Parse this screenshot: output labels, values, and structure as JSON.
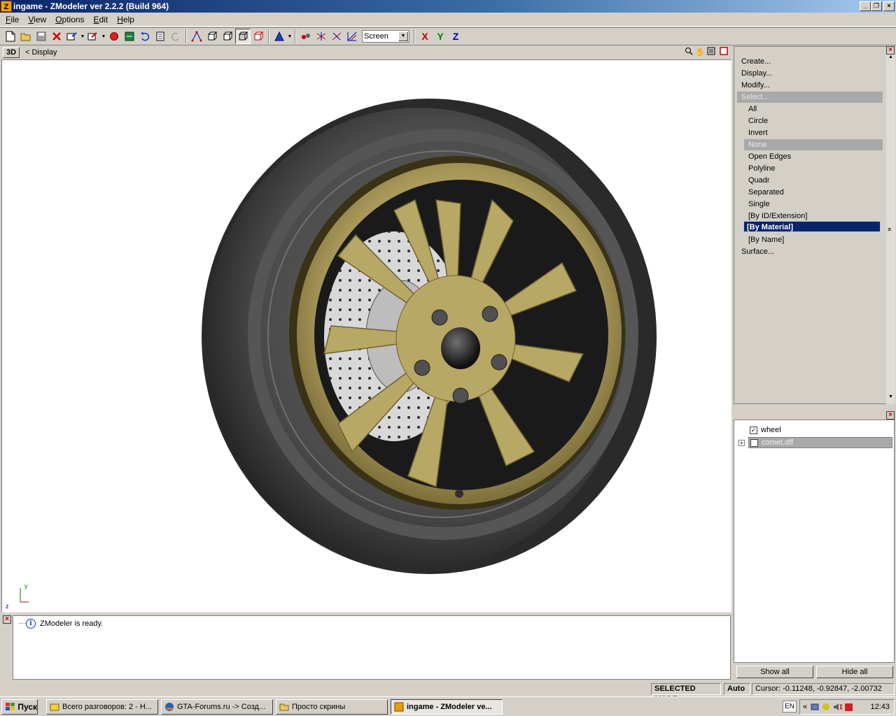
{
  "window": {
    "title": "ingame - ZModeler ver 2.2.2 (Build 964)",
    "app_icon_letter": "Z",
    "controls": [
      "_",
      "❐",
      "×"
    ]
  },
  "menu": {
    "items": [
      {
        "label": "File",
        "accel": "F",
        "rest": "ile"
      },
      {
        "label": "View",
        "accel": "V",
        "rest": "iew"
      },
      {
        "label": "Options",
        "accel": "O",
        "rest": "ptions"
      },
      {
        "label": "Edit",
        "accel": "E",
        "rest": "dit"
      },
      {
        "label": "Help",
        "accel": "H",
        "rest": "elp"
      }
    ]
  },
  "toolbar": {
    "view_select_value": "Screen",
    "axis_x": "X",
    "axis_y": "Y",
    "axis_z": "Z",
    "colors": {
      "axis_x": "#c00000",
      "axis_y": "#008000",
      "axis_z": "#0000c0"
    }
  },
  "viewport": {
    "mode_label": "3D",
    "display_label": "<  Display",
    "axis_y": "y",
    "axis_z": "z"
  },
  "command_panel": {
    "top_items": [
      "Create...",
      "Display...",
      "Modify..."
    ],
    "select_header": "Select...",
    "select_items": [
      "All",
      "Circle",
      "Invert"
    ],
    "none_header": "None",
    "more_items": [
      "Open Edges",
      "Polyline",
      "Quadr",
      "Separated",
      "Single",
      "[By ID/Extension]"
    ],
    "selected_item": "[By Material]",
    "after_selected": "[By Name]",
    "bottom_item": "Surface..."
  },
  "hierarchy": {
    "items": [
      {
        "label": "wheel",
        "checked": true
      },
      {
        "label": "comet.dff",
        "checked": false,
        "selected": true
      }
    ],
    "show_all": "Show all",
    "hide_all": "Hide all"
  },
  "log": {
    "message": "ZModeler is ready."
  },
  "status": {
    "mode": "SELECTED MODE",
    "auto": "Auto",
    "cursor": "Cursor: -0.11248, -0.92847, -2.00732"
  },
  "taskbar": {
    "start": "Пуск",
    "tasks": [
      {
        "label": "Всего разговоров: 2 - Н...",
        "active": false
      },
      {
        "label": "GTA-Forums.ru -> Созд...",
        "active": false
      },
      {
        "label": "Просто скрины",
        "active": false
      },
      {
        "label": "ingame - ZModeler ve...",
        "active": true
      }
    ],
    "lang": "EN",
    "clock": "12:43"
  }
}
